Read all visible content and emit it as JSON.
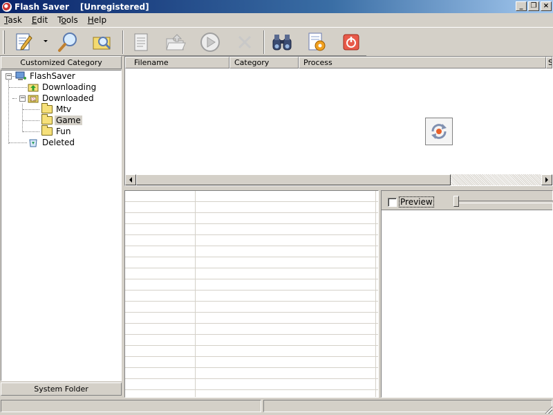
{
  "window": {
    "title": "Flash Saver",
    "subtitle": "[Unregistered]",
    "controls": {
      "minimize": "_",
      "restore": "❐",
      "close": "×"
    }
  },
  "menu": [
    {
      "label": "Task",
      "accel": "T",
      "rest": "ask"
    },
    {
      "label": "Edit",
      "accel": "E",
      "rest": "dit"
    },
    {
      "label": "Tools",
      "pre": "T",
      "accel": "o",
      "rest": "ols"
    },
    {
      "label": "Help",
      "accel": "H",
      "rest": "elp"
    }
  ],
  "toolbar": {
    "buttons": [
      "new-task-icon",
      "search-icon",
      "find-folder-icon",
      "document-icon",
      "open-folder-icon",
      "play-icon",
      "delete-icon",
      "binoculars-icon",
      "settings-icon",
      "power-icon"
    ]
  },
  "left_panel": {
    "header": "Customized Category",
    "footer": "System Folder",
    "tree": {
      "root": "FlashSaver",
      "downloading": "Downloading",
      "downloaded": "Downloaded",
      "mtv": "Mtv",
      "game": "Game",
      "fun": "Fun",
      "deleted": "Deleted"
    }
  },
  "list": {
    "columns": [
      "Filename",
      "Category",
      "Process",
      "S"
    ]
  },
  "preview": {
    "checkbox_label": "Preview",
    "checked": false
  },
  "status": {
    "left": "",
    "right": ""
  }
}
